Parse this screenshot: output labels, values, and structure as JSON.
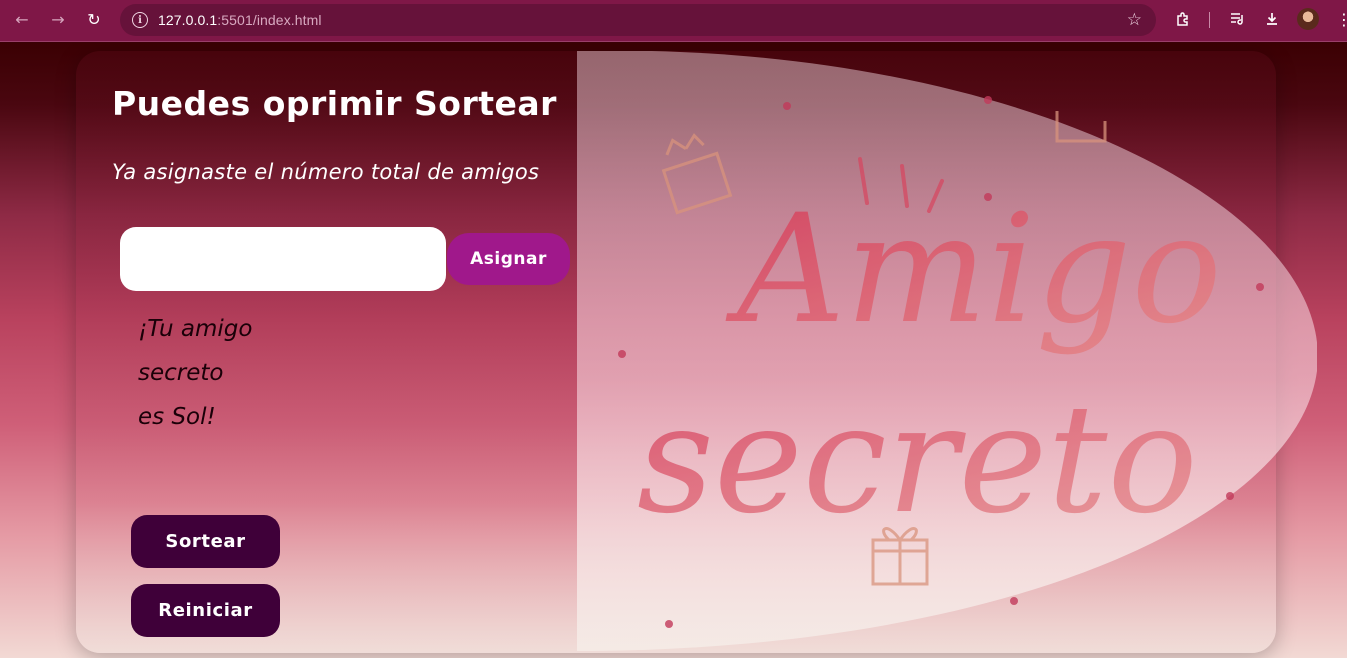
{
  "browser": {
    "url_host": "127.0.0.1",
    "url_path": ":5501/index.html",
    "icons": {
      "back": "arrow-left-icon",
      "forward": "arrow-right-icon",
      "reload": "reload-icon",
      "site_info": "info-icon",
      "bookmark": "star-icon",
      "extensions": "puzzle-icon",
      "media": "media-control-icon",
      "downloads": "download-icon",
      "profile": "avatar-icon",
      "menu": "kebab-menu-icon"
    }
  },
  "main": {
    "title": "Puedes oprimir Sortear",
    "subtitle": "Ya asignaste el número total de amigos",
    "input": {
      "value": "",
      "placeholder": ""
    },
    "assign_button": "Asignar",
    "result_lines": [
      "¡Tu amigo",
      "secreto",
      "es Sol!"
    ],
    "draw_button": "Sortear",
    "reset_button": "Reiniciar"
  },
  "illustration": {
    "line1": "Amigo",
    "line2": "secreto"
  },
  "colors": {
    "chrome": "#7f1747",
    "assign_button": "#a0188b",
    "dark_button": "#3f0039",
    "lettering": "#d8455f"
  }
}
